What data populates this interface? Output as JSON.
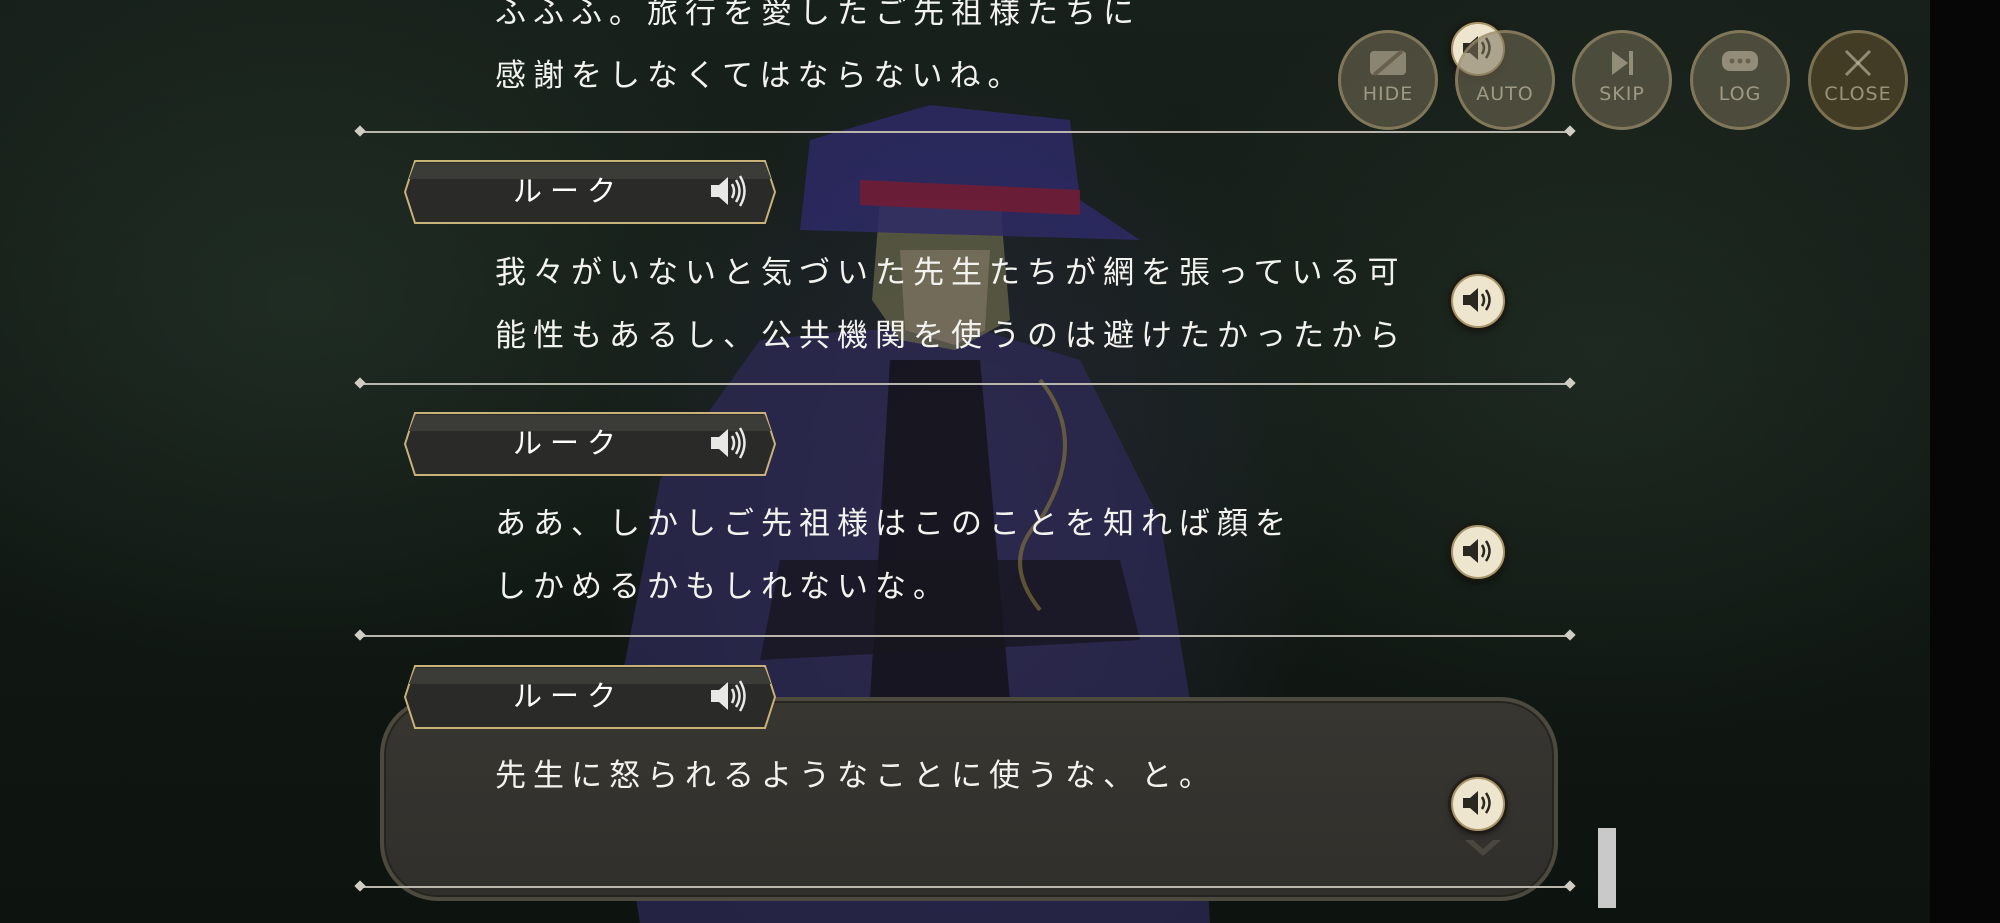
{
  "controls": {
    "hide_label": "HIDE",
    "auto_label": "AUTO",
    "skip_label": "SKIP",
    "log_label": "LOG",
    "close_label": "CLOSE"
  },
  "log": {
    "entries": [
      {
        "speaker": "",
        "lines": [
          "ふふふ。旅行を愛したご先祖様たちに",
          "感謝をしなくてはならないね。"
        ]
      },
      {
        "speaker": "ルーク",
        "lines": [
          "我々がいないと気づいた先生たちが網を張っている可",
          "能性もあるし、公共機関を使うのは避けたかったから"
        ]
      },
      {
        "speaker": "ルーク",
        "lines": [
          "ああ、しかしご先祖様はこのことを知れば顔を",
          "しかめるかもしれないな。"
        ]
      },
      {
        "speaker": "ルーク",
        "lines": [
          "先生に怒られるようなことに使うな、と。"
        ]
      }
    ]
  },
  "icons": {
    "voice": "speaker-icon",
    "next": "chevron-down-icon",
    "hide": "eye-slash-icon",
    "skip": "skip-icon",
    "log": "chat-bubble-icon",
    "close": "close-icon"
  },
  "colors": {
    "text": "#f2f2ee",
    "nameplate_border": "#c9b27a",
    "voice_button": "#eee5cf",
    "current_box": "#35332e"
  }
}
